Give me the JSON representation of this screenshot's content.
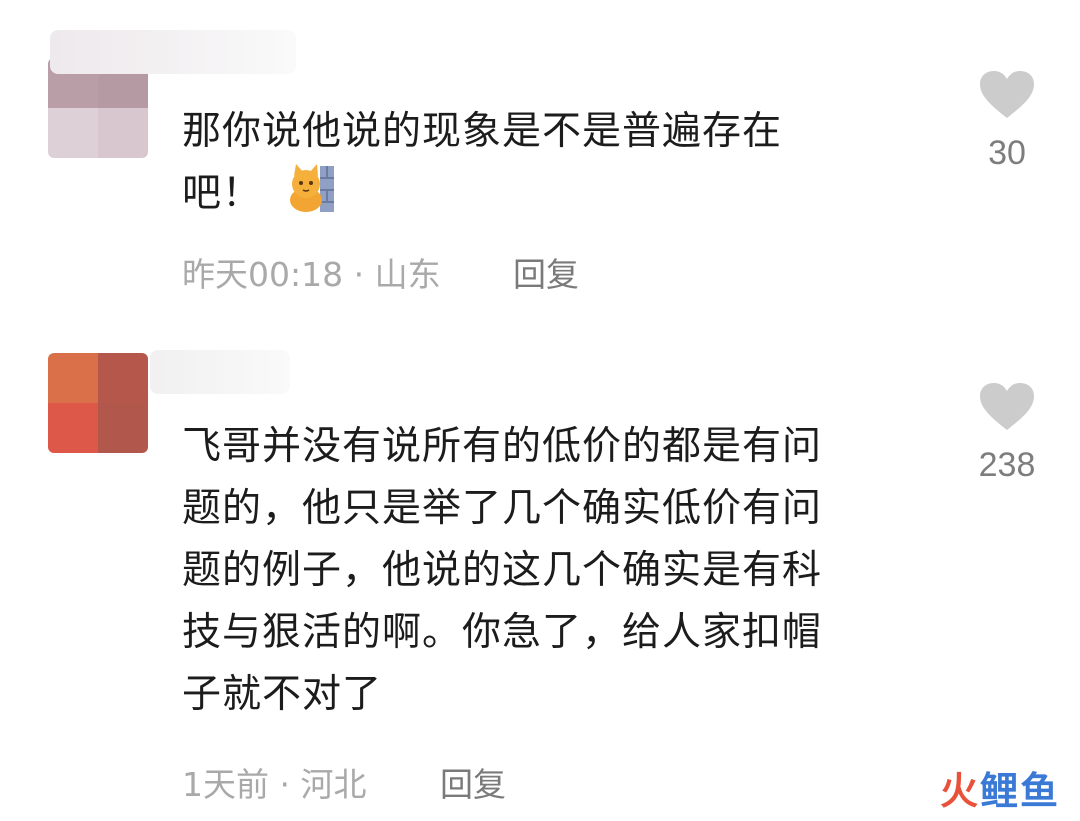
{
  "comments": [
    {
      "text_lines": [
        "那你说他说的现象是不是普遍存在",
        "吧！"
      ],
      "emoji": "cat-peeking-emoji",
      "time": "昨天00:18",
      "separator": "·",
      "location": "山东",
      "reply_label": "回复",
      "likes": "30",
      "avatar_colors": [
        "#b99ea8",
        "#b59aa3",
        "#ddd0d6",
        "#d9c7cf"
      ]
    },
    {
      "text_lines": [
        "飞哥并没有说所有的低价的都是有问",
        "题的，他只是举了几个确实低价有问",
        "题的例子，他说的这几个确实是有科",
        "技与狠活的啊。你急了，给人家扣帽",
        "子就不对了"
      ],
      "time": "1天前",
      "separator": "·",
      "location": "河北",
      "reply_label": "回复",
      "likes": "238",
      "avatar_colors": [
        "#d9704a",
        "#b5574a",
        "#dd5848",
        "#b2574b"
      ]
    }
  ],
  "watermark": {
    "part1": "火",
    "part2": "鲤鱼"
  },
  "colors": {
    "heart": "#cccccc",
    "meta": "#a9a9a9",
    "text": "#1c1c1c"
  }
}
